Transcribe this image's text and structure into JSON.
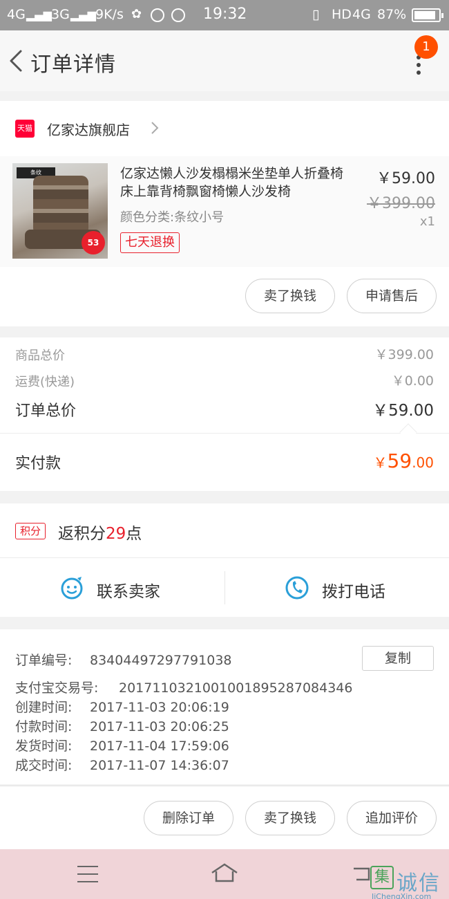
{
  "status_bar": {
    "net1": "4G",
    "net2": "3G",
    "speed": "9K/s",
    "time": "19:32",
    "hd": "HD",
    "net3": "4G",
    "battery": "87%"
  },
  "header": {
    "title": "订单详情",
    "badge_count": "1"
  },
  "shop": {
    "logo_text": "天猫",
    "name": "亿家达旗舰店"
  },
  "item": {
    "title": "亿家达懒人沙发榻榻米坐垫单人折叠椅床上靠背椅飘窗椅懒人沙发椅",
    "spec": "颜色分类:条纹小号",
    "tag": "七天退换",
    "price": "￥59.00",
    "original_price": "￥399.00",
    "quantity": "x1",
    "thumb_sticker": "53",
    "thumb_tag": "条纹"
  },
  "item_actions": {
    "sell": "卖了换钱",
    "after_sale": "申请售后"
  },
  "summary": {
    "goods_total_label": "商品总价",
    "goods_total_value": "￥399.00",
    "shipping_label": "运费(快递)",
    "shipping_value": "￥0.00",
    "order_total_label": "订单总价",
    "order_total_value": "￥59.00",
    "paid_label": "实付款",
    "paid_currency": "￥",
    "paid_int": "59",
    "paid_dec": ".00"
  },
  "points": {
    "tag": "积分",
    "prefix": "返积分",
    "number": "29",
    "suffix": "点"
  },
  "contact": {
    "seller": "联系卖家",
    "phone": "拨打电话"
  },
  "order_info": {
    "copy": "复制",
    "rows": [
      {
        "key": "订单编号:",
        "value": "83404497297791038"
      },
      {
        "key": "支付宝交易号:",
        "value": "2017110321001001895287084346"
      },
      {
        "key": "创建时间:",
        "value": "2017-11-03 20:06:19"
      },
      {
        "key": "付款时间:",
        "value": "2017-11-03 20:06:25"
      },
      {
        "key": "发货时间:",
        "value": "2017-11-04 17:59:06"
      },
      {
        "key": "成交时间:",
        "value": "2017-11-07 14:36:07"
      }
    ]
  },
  "bottom_actions": {
    "delete": "删除订单",
    "sell": "卖了换钱",
    "review": "追加评价"
  },
  "watermark": {
    "box": "集",
    "text": "诚信",
    "url": "JiChengXin.com"
  },
  "colors": {
    "accent": "#ff5000",
    "tmall_red": "#ff0036",
    "tag_red": "#e8202c",
    "contact_blue": "#2a9fd8"
  }
}
